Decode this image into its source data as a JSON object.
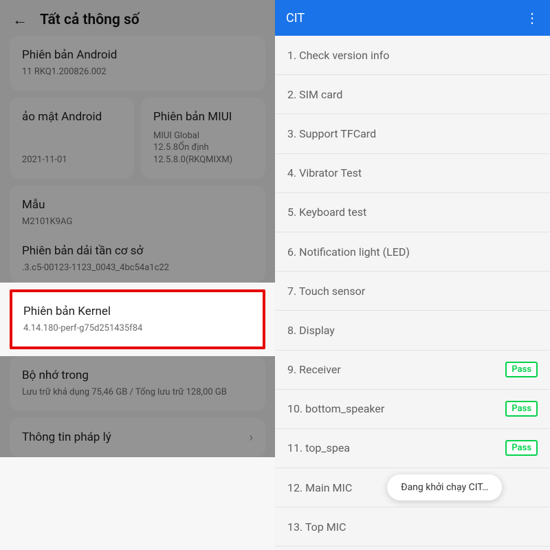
{
  "left": {
    "title": "Tất cả thông số",
    "android": {
      "label": "Phiên bản Android",
      "value": "11 RKQ1.200826.002"
    },
    "security": {
      "label": "ảo mật Android",
      "value": "2021-11-01"
    },
    "miui": {
      "label": "Phiên bản MIUI",
      "value": "MIUI Global\n12.5.8Ổn định\n12.5.8.0(RKQMIXM)"
    },
    "model": {
      "label": "Mẫu",
      "value": "M2101K9AG"
    },
    "baseband": {
      "label": "Phiên bản dải tần cơ sở",
      "value": ".3.c5-00123-1123_0043_4bc54a1c22"
    },
    "kernel": {
      "label": "Phiên bản Kernel",
      "value": "4.14.180-perf-g75d251435f84"
    },
    "storage": {
      "label": "Bộ nhớ trong",
      "value": "Lưu trữ khả dụng   75,46 GB / Tổng lưu trữ   128,00 GB"
    },
    "legal": {
      "label": "Thông tin pháp lý"
    }
  },
  "right": {
    "title": "CIT",
    "items": [
      {
        "label": "1. Check version info",
        "pass": false
      },
      {
        "label": "2. SIM card",
        "pass": false
      },
      {
        "label": "3. Support TFCard",
        "pass": false
      },
      {
        "label": "4. Vibrator Test",
        "pass": false
      },
      {
        "label": "5. Keyboard test",
        "pass": false
      },
      {
        "label": "6. Notification light (LED)",
        "pass": false
      },
      {
        "label": "7. Touch sensor",
        "pass": false
      },
      {
        "label": "8. Display",
        "pass": false
      },
      {
        "label": "9. Receiver",
        "pass": true
      },
      {
        "label": "10. bottom_speaker",
        "pass": true
      },
      {
        "label": "11. top_spea",
        "pass": true
      },
      {
        "label": "12. Main MIC",
        "pass": false
      },
      {
        "label": "13. Top MIC",
        "pass": false
      }
    ],
    "pass_text": "Pass",
    "toast": "Đang khởi chạy CIT…"
  }
}
